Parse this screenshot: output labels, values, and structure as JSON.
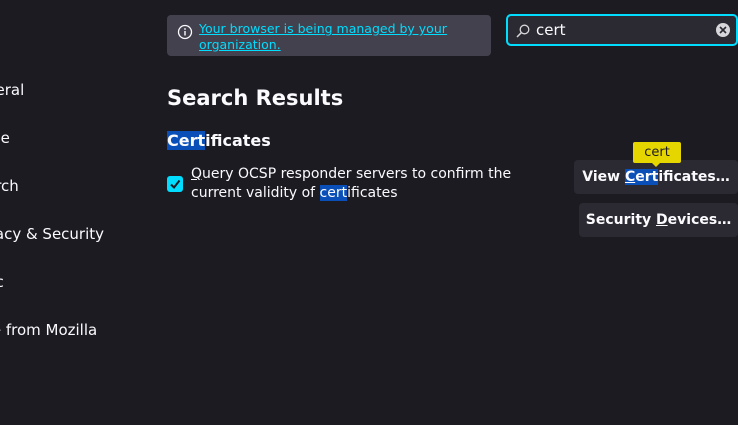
{
  "sidebar": {
    "items": [
      {
        "label": "neral"
      },
      {
        "label": "me"
      },
      {
        "label": "arch"
      },
      {
        "label": "vacy & Security"
      },
      {
        "label": "nc"
      },
      {
        "label": "re from Mozilla"
      }
    ]
  },
  "banner": {
    "link_text": "Your browser is being managed by your organization."
  },
  "search": {
    "value": "cert"
  },
  "results": {
    "title": "Search Results",
    "section": {
      "title_hl": "Cert",
      "title_rest": "ificates"
    },
    "ocsp": {
      "checked": true,
      "text_q": "Q",
      "text_1": "uery OCSP responder servers to confirm the current validity of ",
      "text_hl": "cert",
      "text_2": "ificates"
    }
  },
  "buttons": {
    "view_certs": {
      "pre": "View ",
      "hl_a": "C",
      "hl_b": "ert",
      "post": "ificates…"
    },
    "security_devices": {
      "pre": "Security ",
      "u": "D",
      "post": "evices…"
    }
  },
  "tooltip": {
    "text": "cert"
  },
  "colors": {
    "background": "#1c1b22",
    "accent": "#00ddff",
    "highlight": "#0a4fb8",
    "tooltip": "#e6d600"
  },
  "icons": [
    "info-icon",
    "search-icon",
    "clear-icon",
    "checkmark-icon"
  ]
}
